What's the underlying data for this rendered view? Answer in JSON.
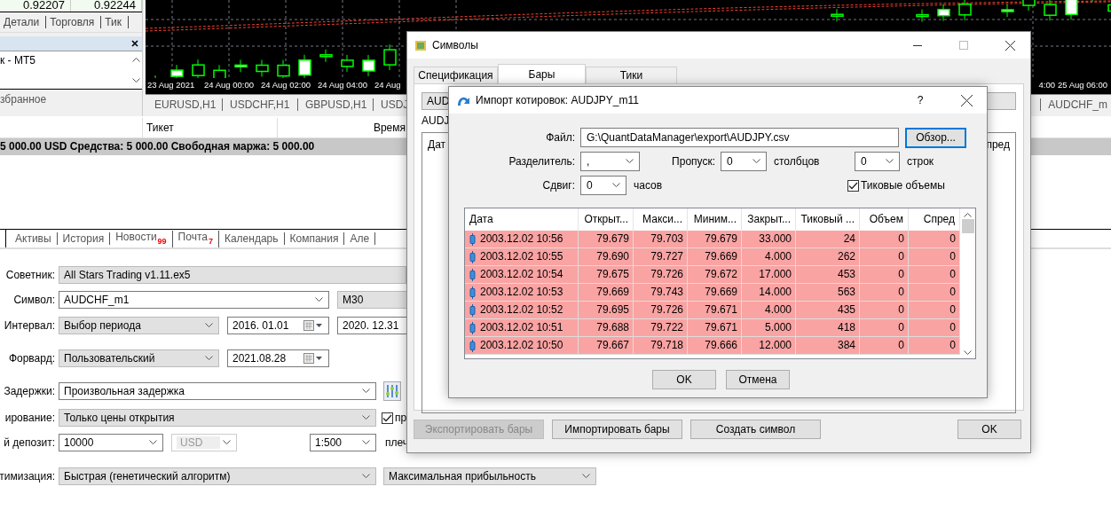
{
  "quote": {
    "bid": "0.92207",
    "ask": "0.92244"
  },
  "left_tabs": [
    "Детали",
    "Торговля",
    "Тик"
  ],
  "navigator": {
    "items": [
      "к - MT5"
    ],
    "footer": "збранное"
  },
  "chart": {
    "time_labels": [
      "23 Aug 2021",
      "24 Aug 00:00",
      "24 Aug 02:00",
      "24 Aug 04:00",
      "24 Aug"
    ],
    "right_labels": [
      "4:00",
      "25 Aug 06:00"
    ]
  },
  "chart_tabs": {
    "left": [
      "EURUSD,H1",
      "USDCHF,H1",
      "GBPUSD,H1",
      "USDJ"
    ],
    "right": [
      "AUDCHF_m"
    ]
  },
  "toolbox": {
    "columns": [
      "Тикет",
      "Время"
    ],
    "balance": "5 000.00 USD  Средства: 5 000.00  Свободная маржа: 5 000.00",
    "tabs": [
      {
        "label": "Активы"
      },
      {
        "label": "История"
      },
      {
        "label": "Новости",
        "badge": "99"
      },
      {
        "label": "Почта",
        "badge": "7"
      },
      {
        "label": "Календарь"
      },
      {
        "label": "Компания"
      },
      {
        "label": "Але"
      }
    ]
  },
  "tester": [
    {
      "label": "Советник:",
      "items": [
        {
          "kind": "readonly",
          "value": "All Stars Trading v1.11.ex5"
        }
      ]
    },
    {
      "label": "Символ:",
      "items": [
        {
          "kind": "combo",
          "value": "AUDCHF_m1"
        },
        {
          "kind": "readonly",
          "value": "M30"
        }
      ]
    },
    {
      "label": "Интервал:",
      "items": [
        {
          "kind": "dropdown",
          "value": "Выбор периода"
        },
        {
          "kind": "date",
          "value": "2016. 01.01"
        },
        {
          "kind": "field",
          "value": "2020. 12.31"
        }
      ]
    },
    {
      "label": "Форвард:",
      "items": [
        {
          "kind": "dropdown",
          "value": "Пользовательский"
        },
        {
          "kind": "date",
          "value": "2021.08.28"
        }
      ]
    },
    {
      "label": "Задержки:",
      "items": [
        {
          "kind": "combo",
          "value": "Произвольная задержка"
        },
        {
          "kind": "settings"
        }
      ]
    },
    {
      "label": "ирование:",
      "items": [
        {
          "kind": "dropdown",
          "value": "Только цены открытия"
        },
        {
          "kind": "checkbox",
          "value": "пр",
          "checked": true
        }
      ]
    },
    {
      "label": "й депозит:",
      "items": [
        {
          "kind": "combo",
          "value": "10000"
        },
        {
          "kind": "disabled",
          "value": "USD"
        },
        {
          "kind": "combo",
          "value": "1:500"
        },
        {
          "kind": "text",
          "value": "плеч"
        }
      ]
    },
    {
      "label": "тимизация:",
      "items": [
        {
          "kind": "dropdown",
          "value": "Быстрая (генетический алгоритм)"
        },
        {
          "kind": "dropdown",
          "value": "Максимальная прибыльность"
        }
      ]
    }
  ],
  "symbols_window": {
    "title": "Символы",
    "tabs": [
      {
        "label": "Спецификация",
        "selected": false
      },
      {
        "label": "Бары",
        "selected": true
      },
      {
        "label": "Тики",
        "selected": false
      }
    ],
    "symbol_field": "AUD",
    "symbol_label": "AUDJ",
    "columns": [
      "Дат",
      "пред"
    ],
    "buttons": [
      {
        "label": "Экспортировать бары",
        "disabled": true
      },
      {
        "label": "Импортировать бары",
        "disabled": false
      },
      {
        "label": "Создать символ",
        "disabled": false
      },
      {
        "label": "OK",
        "disabled": false
      }
    ]
  },
  "import_dialog": {
    "title": "Импорт котировок: AUDJPY_m11",
    "help": "?",
    "file_label": "Файл:",
    "file": "G:\\QuantDataManager\\export\\AUDJPY.csv",
    "browse": "Обзор...",
    "separator_label": "Разделитель:",
    "separator": ",",
    "skip_label": "Пропуск:",
    "skip_columns": "0",
    "columns_unit": "столбцов",
    "skip_rows": "0",
    "rows_unit": "строк",
    "shift_label": "Сдвиг:",
    "shift": "0",
    "shift_unit": "часов",
    "tick_volumes": {
      "label": "Тиковые объемы",
      "checked": true
    },
    "columns": [
      "Дата",
      "Открыт...",
      "Макси...",
      "Миним...",
      "Закрыт...",
      "Тиковый ...",
      "Объем",
      "Спред"
    ],
    "rows": [
      [
        "2003.12.02 10:56",
        "79.679",
        "79.703",
        "79.679",
        "33.000",
        "24",
        "0",
        "0"
      ],
      [
        "2003.12.02 10:55",
        "79.690",
        "79.727",
        "79.669",
        "4.000",
        "262",
        "0",
        "0"
      ],
      [
        "2003.12.02 10:54",
        "79.675",
        "79.726",
        "79.672",
        "17.000",
        "453",
        "0",
        "0"
      ],
      [
        "2003.12.02 10:53",
        "79.669",
        "79.743",
        "79.669",
        "14.000",
        "563",
        "0",
        "0"
      ],
      [
        "2003.12.02 10:52",
        "79.695",
        "79.726",
        "79.671",
        "4.000",
        "435",
        "0",
        "0"
      ],
      [
        "2003.12.02 10:51",
        "79.688",
        "79.722",
        "79.671",
        "5.000",
        "418",
        "0",
        "0"
      ],
      [
        "2003.12.02 10:50",
        "79.667",
        "79.718",
        "79.666",
        "12.000",
        "384",
        "0",
        "0"
      ]
    ],
    "buttons": [
      "OK",
      "Отмена"
    ]
  }
}
